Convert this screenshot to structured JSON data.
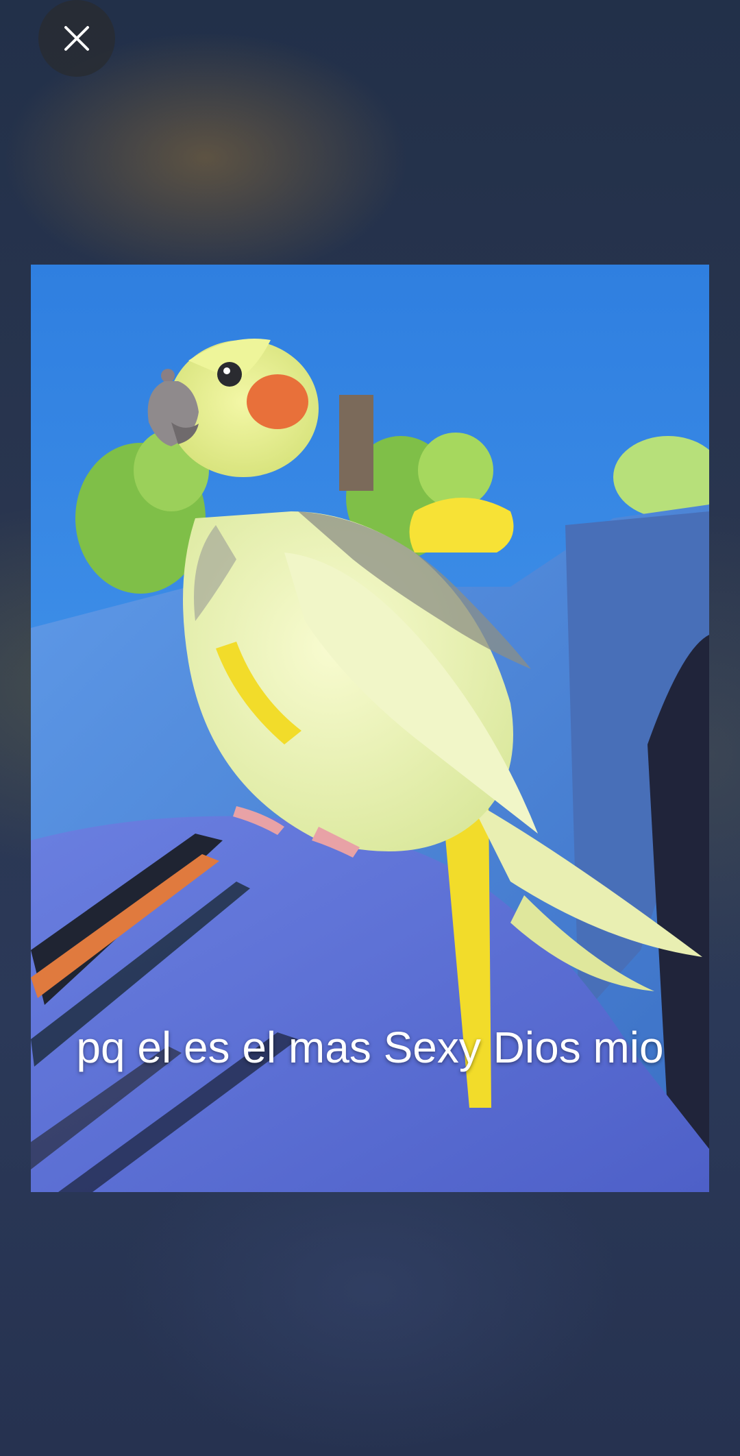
{
  "viewer": {
    "close_label": "Close",
    "caption": "pq el es el mas Sexy Dios mio"
  },
  "colors": {
    "background": "#27324a",
    "sky": "#3b8fe6",
    "shirt": "#5b6fd1",
    "bird_body": "#eef5b5",
    "cheek": "#e8703a",
    "harness": "#f4e235"
  },
  "icons": {
    "close": "close-icon"
  }
}
